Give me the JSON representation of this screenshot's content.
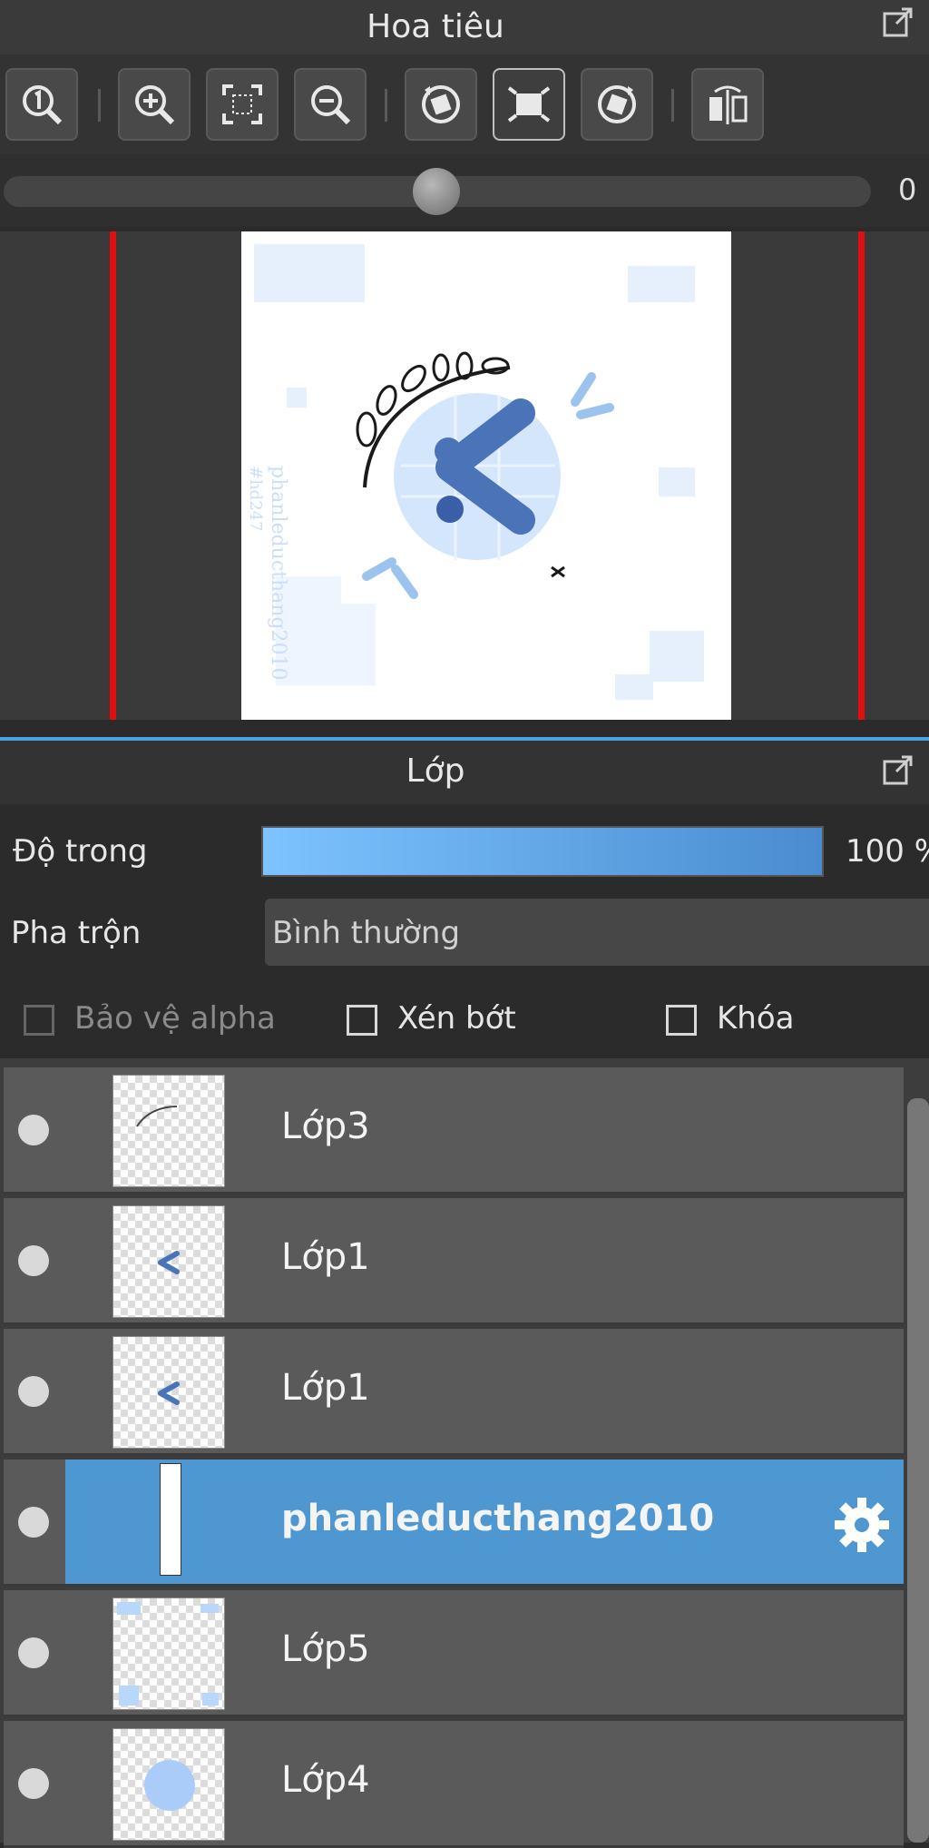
{
  "navigator": {
    "title": "Hoa tiêu",
    "rotation_value": "0",
    "toolbar_icons": [
      "zoom-actual-icon",
      "zoom-in-icon",
      "fit-screen-icon",
      "zoom-out-icon",
      "rotate-left-icon",
      "fit-rotate-icon",
      "rotate-right-icon",
      "flip-horizontal-icon"
    ]
  },
  "layers_panel": {
    "title": "Lớp",
    "opacity_label": "Độ trong",
    "opacity_value": "100 %",
    "opacity_fraction": 1.0,
    "blend_label": "Pha trộn",
    "blend_value": "Bình thường",
    "checks": {
      "alpha_protect": "Bảo vệ alpha",
      "clipping": "Xén bớt",
      "lock": "Khóa"
    },
    "layers": [
      {
        "name": "Lớp3",
        "selected": false
      },
      {
        "name": "Lớp1",
        "selected": false
      },
      {
        "name": "Lớp1",
        "selected": false
      },
      {
        "name": "phanleducthang2010",
        "selected": true
      },
      {
        "name": "Lớp5",
        "selected": false
      },
      {
        "name": "Lớp4",
        "selected": false
      }
    ]
  },
  "canvas_watermark": {
    "line1": "phanleducthang2010",
    "line2": "#hd247"
  },
  "colors": {
    "accent": "#4f97d1",
    "red_guide": "#e01010"
  }
}
